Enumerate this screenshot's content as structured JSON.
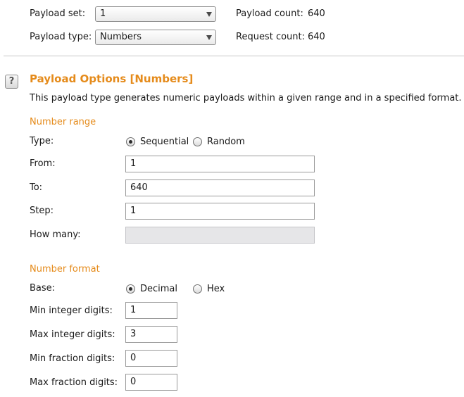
{
  "payload": {
    "set_label": "Payload set:",
    "set_value": "1",
    "type_label": "Payload type:",
    "type_value": "Numbers",
    "count_label": "Payload count:",
    "count_value": "640",
    "request_label": "Request count:",
    "request_value": "640"
  },
  "options": {
    "help_glyph": "?",
    "title": "Payload Options [Numbers]",
    "description": "This payload type generates numeric payloads within a given range and in a specified format."
  },
  "number_range": {
    "title": "Number range",
    "type_label": "Type:",
    "type_options": [
      {
        "label": "Sequential",
        "selected": true
      },
      {
        "label": "Random",
        "selected": false
      }
    ],
    "from_label": "From:",
    "from_value": "1",
    "to_label": "To:",
    "to_value": "640",
    "step_label": "Step:",
    "step_value": "1",
    "how_many_label": "How many:",
    "how_many_value": ""
  },
  "number_format": {
    "title": "Number format",
    "base_label": "Base:",
    "base_options": [
      {
        "label": "Decimal",
        "selected": true
      },
      {
        "label": "Hex",
        "selected": false
      }
    ],
    "min_int_label": "Min integer digits:",
    "min_int_value": "1",
    "max_int_label": "Max integer digits:",
    "max_int_value": "3",
    "min_frac_label": "Min fraction digits:",
    "min_frac_value": "0",
    "max_frac_label": "Max fraction digits:",
    "max_frac_value": "0"
  },
  "icons": {
    "help": "help-icon",
    "dropdown": "chevron-down-icon"
  },
  "colors": {
    "accent": "#e58b1b",
    "disabled_field": "#e6e6e8"
  }
}
